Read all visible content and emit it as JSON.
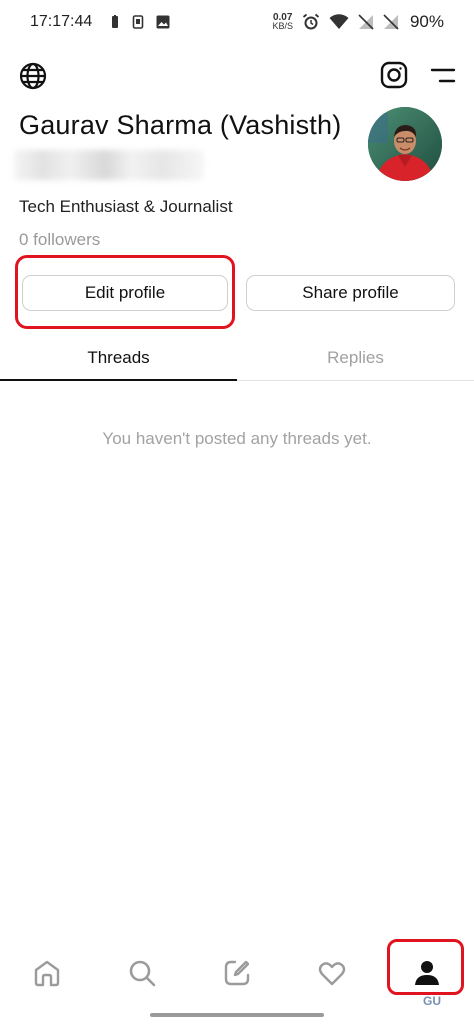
{
  "status_bar": {
    "time": "17:17:44",
    "net_speed_value": "0.07",
    "net_speed_unit": "KB/S",
    "battery": "90%"
  },
  "profile": {
    "name": "Gaurav Sharma (Vashisth)",
    "bio": "Tech Enthusiast & Journalist",
    "followers": "0 followers"
  },
  "buttons": {
    "edit_profile": "Edit profile",
    "share_profile": "Share profile"
  },
  "tabs": [
    {
      "label": "Threads",
      "active": true
    },
    {
      "label": "Replies",
      "active": false
    }
  ],
  "empty_state": "You haven't posted any threads yet.",
  "bottom_nav": [
    {
      "icon": "home-icon"
    },
    {
      "icon": "search-icon"
    },
    {
      "icon": "compose-icon"
    },
    {
      "icon": "heart-icon"
    },
    {
      "icon": "profile-icon",
      "active": true
    }
  ],
  "watermark": "GU",
  "colors": {
    "highlight": "#e0141e",
    "text_primary": "#111111",
    "text_muted": "#a0a0a0"
  }
}
